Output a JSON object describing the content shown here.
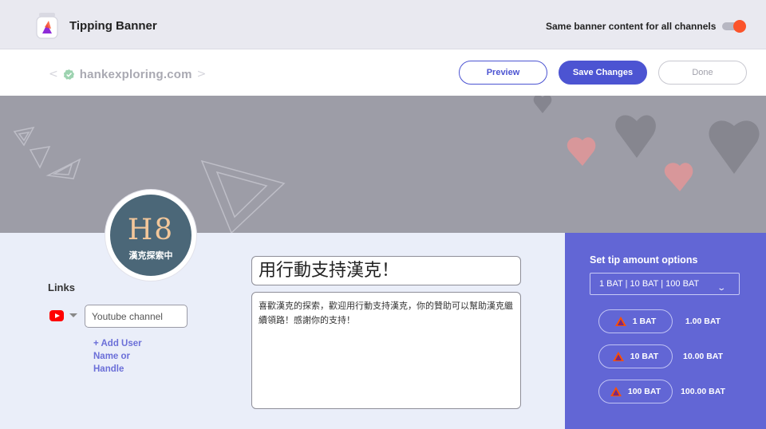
{
  "header": {
    "title": "Tipping Banner",
    "same_content_label": "Same banner content for all channels",
    "toggle_on": true,
    "toggle_color": "#fb542b"
  },
  "toolbar": {
    "domain": "hankexploring.com",
    "prev_chevron": "<",
    "next_chevron": ">",
    "preview_label": "Preview",
    "save_label": "Save Changes",
    "done_label": "Done"
  },
  "logo": {
    "monogram": "H8",
    "subtitle": "漢克探索中"
  },
  "links": {
    "label": "Links",
    "channel_icon": "youtube-icon",
    "channel_placeholder": "Youtube channel",
    "add_user": "+ Add User Name or Handle"
  },
  "content": {
    "title": "用行動支持漢克！",
    "description": "喜歡漢克的探索，歡迎用行動支持漢克，你的贊助可以幫助漢克繼續領路！感謝你的支持！"
  },
  "tips": {
    "heading": "Set tip amount options",
    "selected_option": "1 BAT | 10 BAT | 100 BAT",
    "options": [
      {
        "label": "1 BAT",
        "value": "1.00 BAT"
      },
      {
        "label": "10 BAT",
        "value": "10.00 BAT"
      },
      {
        "label": "100 BAT",
        "value": "100.00 BAT"
      }
    ],
    "panel_color": "#6266d5"
  },
  "colors": {
    "accent": "#4c54d2",
    "banner": "#9d9da7",
    "lower_bg": "#eaeef9"
  }
}
